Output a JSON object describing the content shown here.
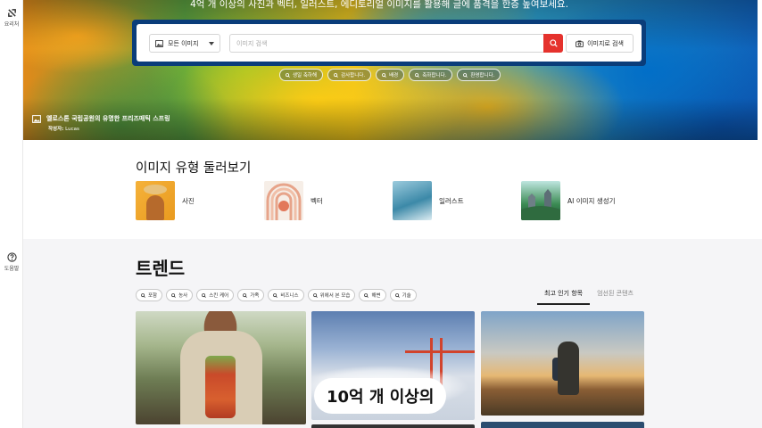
{
  "sidebar": {
    "top_item": {
      "label": "요리처",
      "icon": "logo-icon"
    },
    "help_item": {
      "label": "도움말",
      "icon": "help-icon"
    }
  },
  "hero": {
    "subtitle": "4억 개 이상의 사진과 벡터, 일러스트, 에디토리얼 이미지를 활용해 글에 품격을 한층 높여보세요.",
    "search": {
      "type_select_value": "모든 이미지",
      "placeholder": "이미지 검색",
      "image_search_label": "이미지로 검색"
    },
    "suggestions": [
      "생일 축하해",
      "감사합니다.",
      "배경",
      "축하합니다.",
      "환영합니다."
    ],
    "caption": {
      "title": "옐로스톤 국립공원의 유명한 프리즈매틱 스프링",
      "author_label": "작성자:",
      "author_name": "Lucas"
    }
  },
  "explore": {
    "title": "이미지 유형 둘러보기",
    "types": [
      {
        "label": "사진"
      },
      {
        "label": "벡터"
      },
      {
        "label": "일러스트"
      },
      {
        "label": "AI 이미지 생성기"
      }
    ]
  },
  "trends": {
    "title": "트렌드",
    "filters": [
      "포함",
      "농사",
      "스킨 케어",
      "가족",
      "비즈니스",
      "위에서 본 모습",
      "해변",
      "기술"
    ],
    "tabs": [
      {
        "label": "최고 인기 항목",
        "active": true
      },
      {
        "label": "엄선된 콘텐츠",
        "active": false
      }
    ],
    "overlay_label": "10억 개 이상의"
  },
  "colors": {
    "accent_red": "#e5322d",
    "search_panel": "#0a3d7a"
  }
}
